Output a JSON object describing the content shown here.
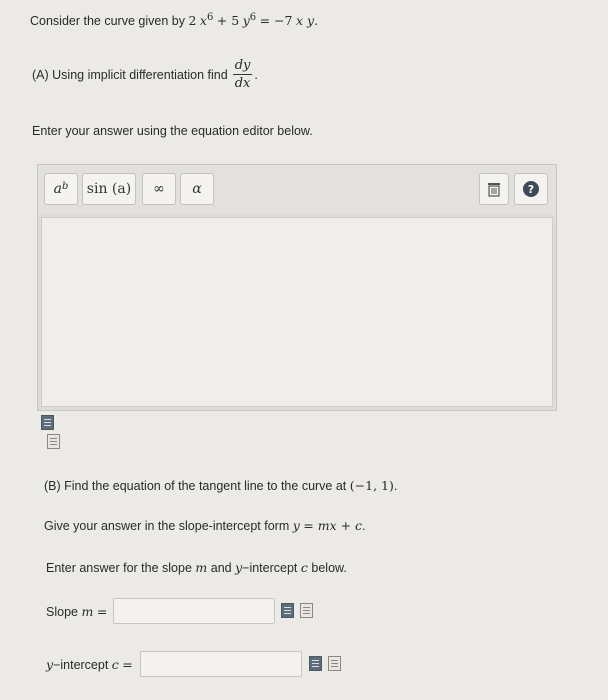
{
  "question": {
    "intro": "Consider the curve given by",
    "equation": "2 x^6 + 5 y^6 = −7 x y.",
    "eq_coef1": "2",
    "eq_var1": "x",
    "eq_exp1": "6",
    "eq_plus": "+ 5",
    "eq_var2": "y",
    "eq_exp2": "6",
    "eq_rhs": "= −7",
    "eq_xy": "x y",
    "eq_end": ".",
    "part_a": "(A) Using implicit differentiation find",
    "dydx_num": "dy",
    "dydx_den": "dx",
    "part_a_end": ".",
    "editor_instructions": "Enter your answer using the equation editor below."
  },
  "editor": {
    "toolbar": {
      "power_base": "a",
      "power_exp": "b",
      "sin_label": "sin",
      "sin_arg": "(a)",
      "infinity": "∞",
      "alpha": "α"
    },
    "delete_icon": "trash-icon",
    "help_icon": "question-icon",
    "help_glyph": "?"
  },
  "part_b": {
    "heading_prefix": "(B) Find the equation of the tangent line to the curve at",
    "point": "(−1, 1)",
    "heading_end": ".",
    "form_prefix": "Give your answer in the slope-intercept form",
    "form_eq_y": "y",
    "form_eq_rest": "= mx + c",
    "form_end": ".",
    "enter_prefix": "Enter answer for the slope",
    "enter_m": "m",
    "enter_mid": "and",
    "enter_y": "y",
    "enter_mid2": "−intercept",
    "enter_c": "c",
    "enter_end": "below.",
    "slope_label": "Slope",
    "slope_var": "m",
    "slope_eq": "=",
    "slope_value": "",
    "intercept_y": "y",
    "intercept_label": "−intercept",
    "intercept_var": "c",
    "intercept_eq": "=",
    "intercept_value": ""
  }
}
